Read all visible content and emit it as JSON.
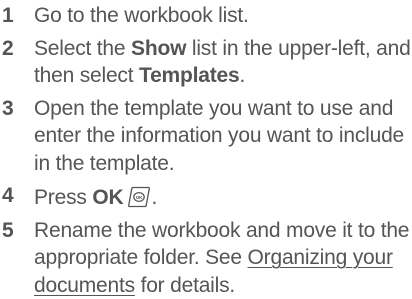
{
  "steps": [
    {
      "number": "1",
      "parts": [
        {
          "text": "Go to the workbook list."
        }
      ]
    },
    {
      "number": "2",
      "parts": [
        {
          "text": "Select the "
        },
        {
          "text": "Show"
        },
        {
          "text": " list in the upper-left, and then select "
        },
        {
          "text": "Templates"
        },
        {
          "text": "."
        }
      ]
    },
    {
      "number": "3",
      "parts": [
        {
          "text": "Open the template you want to use and enter the information you want to include in the template."
        }
      ]
    },
    {
      "number": "4",
      "parts": [
        {
          "text": "Press "
        },
        {
          "text": "OK"
        },
        {
          "text": "."
        }
      ],
      "icon": "ok-button-icon"
    },
    {
      "number": "5",
      "parts": [
        {
          "text": "Rename the workbook and move it to the appropriate folder. See "
        },
        {
          "text": "Organizing your documents"
        },
        {
          "text": " for details."
        }
      ]
    }
  ]
}
